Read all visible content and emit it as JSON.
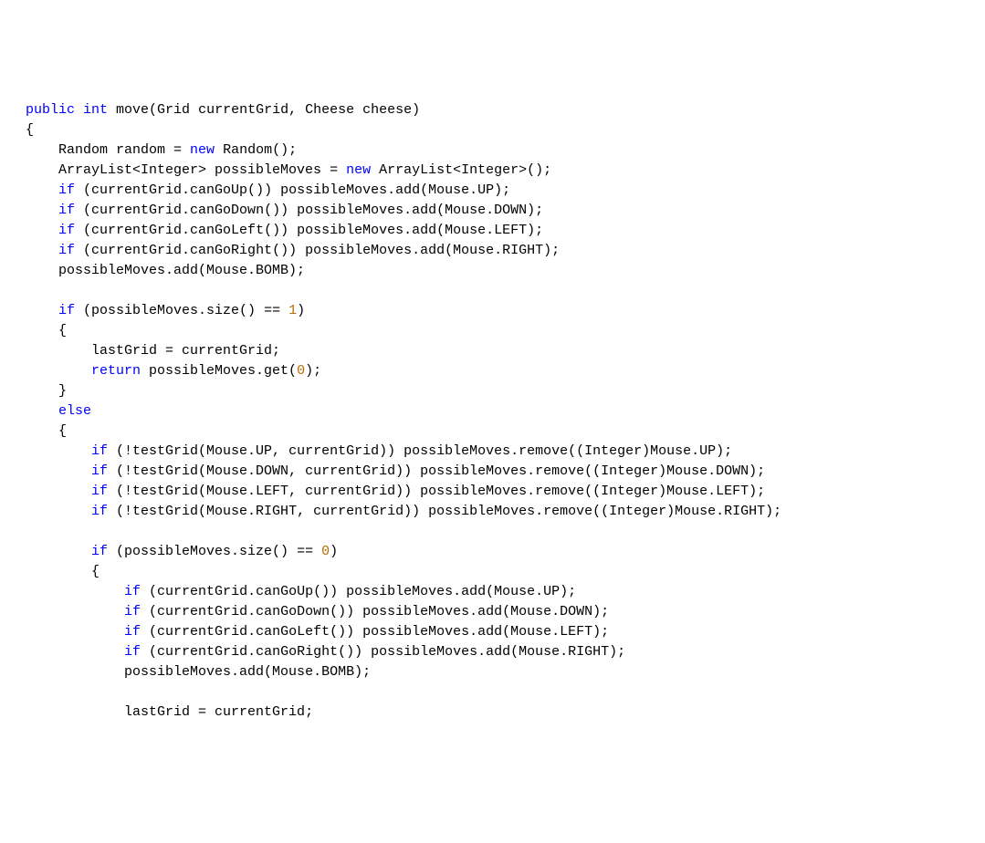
{
  "code": {
    "lines": [
      {
        "indent": 0,
        "segments": [
          {
            "t": "public",
            "c": "kw"
          },
          {
            "t": " "
          },
          {
            "t": "int",
            "c": "kw"
          },
          {
            "t": " move(Grid currentGrid, Cheese cheese)"
          }
        ]
      },
      {
        "indent": 0,
        "segments": [
          {
            "t": "{"
          }
        ]
      },
      {
        "indent": 1,
        "segments": [
          {
            "t": "Random random = "
          },
          {
            "t": "new",
            "c": "kw"
          },
          {
            "t": " Random();"
          }
        ]
      },
      {
        "indent": 1,
        "segments": [
          {
            "t": "ArrayList<Integer> possibleMoves = "
          },
          {
            "t": "new",
            "c": "kw"
          },
          {
            "t": " ArrayList<Integer>();"
          }
        ]
      },
      {
        "indent": 1,
        "segments": [
          {
            "t": "if",
            "c": "kw"
          },
          {
            "t": " (currentGrid.canGoUp()) possibleMoves.add(Mouse.UP);"
          }
        ]
      },
      {
        "indent": 1,
        "segments": [
          {
            "t": "if",
            "c": "kw"
          },
          {
            "t": " (currentGrid.canGoDown()) possibleMoves.add(Mouse.DOWN);"
          }
        ]
      },
      {
        "indent": 1,
        "segments": [
          {
            "t": "if",
            "c": "kw"
          },
          {
            "t": " (currentGrid.canGoLeft()) possibleMoves.add(Mouse.LEFT);"
          }
        ]
      },
      {
        "indent": 1,
        "segments": [
          {
            "t": "if",
            "c": "kw"
          },
          {
            "t": " (currentGrid.canGoRight()) possibleMoves.add(Mouse.RIGHT);"
          }
        ]
      },
      {
        "indent": 1,
        "segments": [
          {
            "t": "possibleMoves.add(Mouse.BOMB);"
          }
        ]
      },
      {
        "indent": 1,
        "segments": [
          {
            "t": " "
          }
        ]
      },
      {
        "indent": 1,
        "segments": [
          {
            "t": "if",
            "c": "kw"
          },
          {
            "t": " (possibleMoves.size() == "
          },
          {
            "t": "1",
            "c": "num"
          },
          {
            "t": ")"
          }
        ]
      },
      {
        "indent": 1,
        "segments": [
          {
            "t": "{"
          }
        ]
      },
      {
        "indent": 2,
        "segments": [
          {
            "t": "lastGrid = currentGrid;"
          }
        ]
      },
      {
        "indent": 2,
        "segments": [
          {
            "t": "return",
            "c": "kw"
          },
          {
            "t": " possibleMoves.get("
          },
          {
            "t": "0",
            "c": "num"
          },
          {
            "t": ");"
          }
        ]
      },
      {
        "indent": 1,
        "segments": [
          {
            "t": "}"
          }
        ]
      },
      {
        "indent": 1,
        "segments": [
          {
            "t": "else",
            "c": "kw"
          }
        ]
      },
      {
        "indent": 1,
        "segments": [
          {
            "t": "{"
          }
        ]
      },
      {
        "indent": 2,
        "segments": [
          {
            "t": "if",
            "c": "kw"
          },
          {
            "t": " (!testGrid(Mouse.UP, currentGrid)) possibleMoves.remove((Integer)Mouse.UP);"
          }
        ]
      },
      {
        "indent": 2,
        "segments": [
          {
            "t": "if",
            "c": "kw"
          },
          {
            "t": " (!testGrid(Mouse.DOWN, currentGrid)) possibleMoves.remove((Integer)Mouse.DOWN);"
          }
        ]
      },
      {
        "indent": 2,
        "segments": [
          {
            "t": "if",
            "c": "kw"
          },
          {
            "t": " (!testGrid(Mouse.LEFT, currentGrid)) possibleMoves.remove((Integer)Mouse.LEFT);"
          }
        ]
      },
      {
        "indent": 2,
        "segments": [
          {
            "t": "if",
            "c": "kw"
          },
          {
            "t": " (!testGrid(Mouse.RIGHT, currentGrid)) possibleMoves.remove((Integer)Mouse.RIGHT);"
          }
        ]
      },
      {
        "indent": 2,
        "segments": [
          {
            "t": " "
          }
        ]
      },
      {
        "indent": 2,
        "segments": [
          {
            "t": "if",
            "c": "kw"
          },
          {
            "t": " (possibleMoves.size() == "
          },
          {
            "t": "0",
            "c": "num"
          },
          {
            "t": ")"
          }
        ]
      },
      {
        "indent": 2,
        "segments": [
          {
            "t": "{"
          }
        ]
      },
      {
        "indent": 3,
        "segments": [
          {
            "t": "if",
            "c": "kw"
          },
          {
            "t": " (currentGrid.canGoUp()) possibleMoves.add(Mouse.UP);"
          }
        ]
      },
      {
        "indent": 3,
        "segments": [
          {
            "t": "if",
            "c": "kw"
          },
          {
            "t": " (currentGrid.canGoDown()) possibleMoves.add(Mouse.DOWN);"
          }
        ]
      },
      {
        "indent": 3,
        "segments": [
          {
            "t": "if",
            "c": "kw"
          },
          {
            "t": " (currentGrid.canGoLeft()) possibleMoves.add(Mouse.LEFT);"
          }
        ]
      },
      {
        "indent": 3,
        "segments": [
          {
            "t": "if",
            "c": "kw"
          },
          {
            "t": " (currentGrid.canGoRight()) possibleMoves.add(Mouse.RIGHT);"
          }
        ]
      },
      {
        "indent": 3,
        "segments": [
          {
            "t": "possibleMoves.add(Mouse.BOMB);"
          }
        ]
      },
      {
        "indent": 3,
        "segments": [
          {
            "t": " "
          }
        ]
      },
      {
        "indent": 3,
        "segments": [
          {
            "t": "lastGrid = currentGrid;"
          }
        ]
      }
    ],
    "indentString": "    "
  }
}
